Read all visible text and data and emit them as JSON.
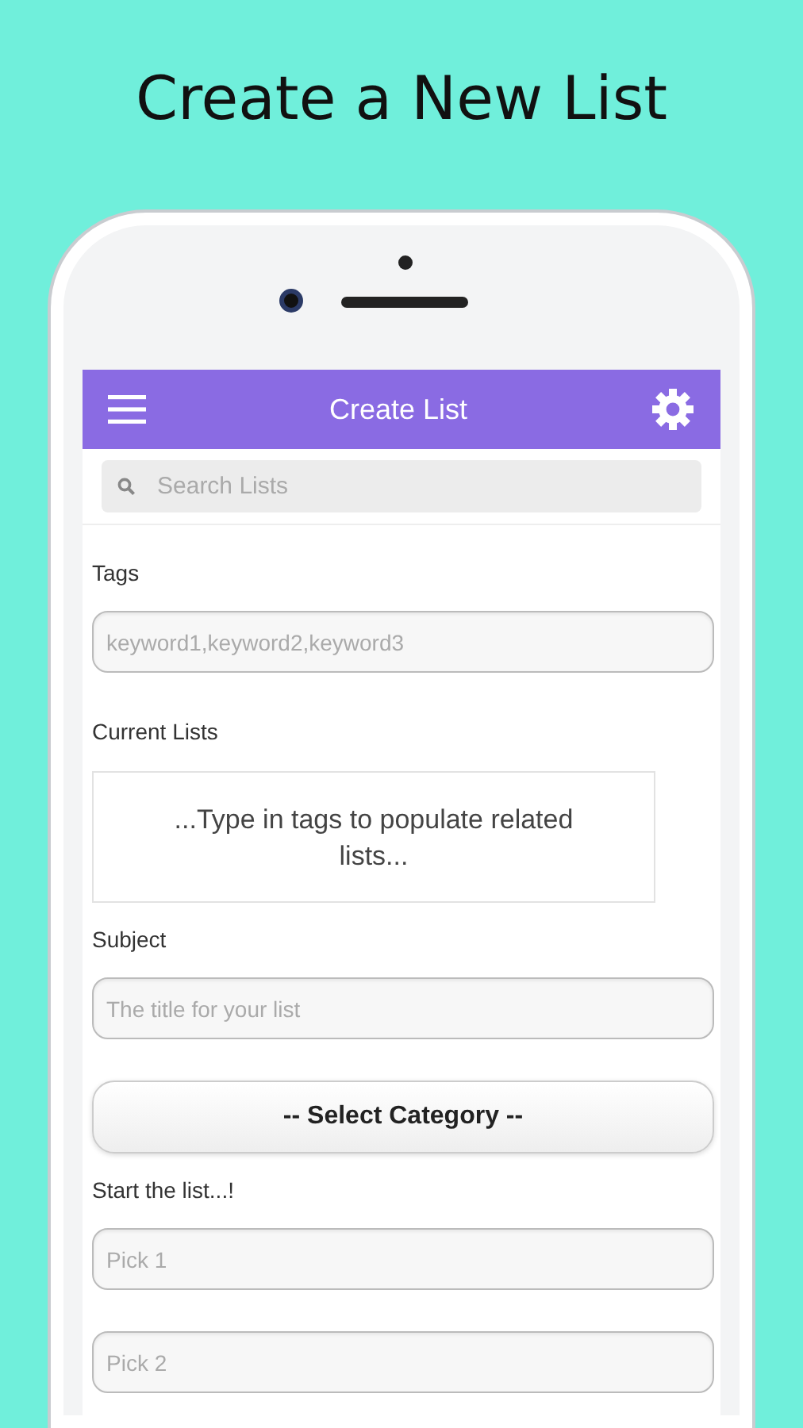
{
  "headline": "Create a New List",
  "app_bar": {
    "title": "Create List"
  },
  "search": {
    "placeholder": "Search Lists"
  },
  "form": [
    {
      "kind": "label",
      "text": "Tags"
    },
    {
      "kind": "field",
      "placeholder": "keyword1,keyword2,keyword3"
    },
    {
      "kind": "label",
      "text": "Current Lists"
    },
    {
      "kind": "note",
      "text": "...Type in tags to populate related lists..."
    },
    {
      "kind": "label",
      "text": "Subject"
    },
    {
      "kind": "field",
      "placeholder": "The title for your list"
    },
    {
      "kind": "select",
      "text": "-- Select Category --"
    },
    {
      "kind": "label",
      "text": "Start the list...!"
    },
    {
      "kind": "field",
      "placeholder": "Pick 1"
    },
    {
      "kind": "field",
      "placeholder": "Pick 2"
    }
  ]
}
